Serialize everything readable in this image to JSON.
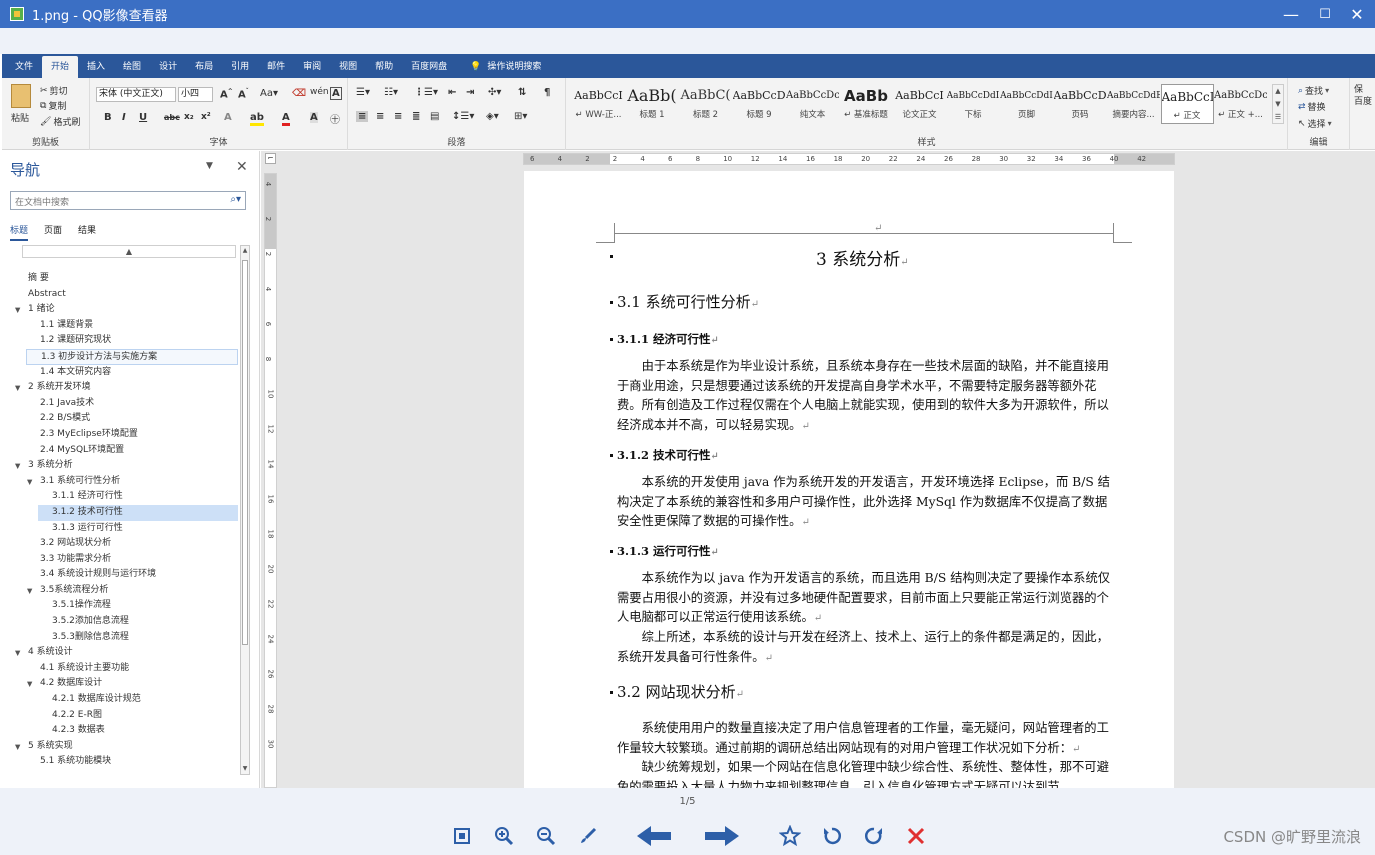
{
  "window": {
    "title": "1.png - QQ影像查看器",
    "minimize": "—",
    "maximize": "☐",
    "close": "✕"
  },
  "ribbon_tabs": [
    "文件",
    "开始",
    "插入",
    "绘图",
    "设计",
    "布局",
    "引用",
    "邮件",
    "审阅",
    "视图",
    "帮助",
    "百度网盘"
  ],
  "tell_me": "操作说明搜索",
  "clipboard": {
    "paste": "粘贴",
    "cut": "剪切",
    "copy": "复制",
    "format_painter": "格式刷",
    "label": "剪贴板"
  },
  "font": {
    "name": "宋体 (中文正文)",
    "size": "小四",
    "label": "字体"
  },
  "paragraph": {
    "label": "段落"
  },
  "styles": {
    "label": "样式",
    "items": [
      {
        "preview": "AaBbCcI",
        "name": "↵ WW-正..."
      },
      {
        "preview": "AaBb(",
        "name": "标题 1"
      },
      {
        "preview": "AaBbC(",
        "name": "标题 2"
      },
      {
        "preview": "AaBbCcD",
        "name": "标题 9"
      },
      {
        "preview": "AaBbCcDc",
        "name": "纯文本"
      },
      {
        "preview": "AaBb",
        "name": "↵ 基准标题"
      },
      {
        "preview": "AaBbCcI",
        "name": "论文正文"
      },
      {
        "preview": "AaBbCcDdI",
        "name": "下标"
      },
      {
        "preview": "AaBbCcDdI",
        "name": "页脚"
      },
      {
        "preview": "AaBbCcD",
        "name": "页码"
      },
      {
        "preview": "AaBbCcDdE",
        "name": "摘要内容..."
      },
      {
        "preview": "AaBbCcI",
        "name": "↵ 正文"
      },
      {
        "preview": "AaBbCcDc",
        "name": "↵ 正文 +..."
      }
    ]
  },
  "editing": {
    "find": "查找",
    "replace": "替换",
    "select": "选择",
    "label": "编辑",
    "extra": "保\n百度"
  },
  "nav": {
    "title": "导航",
    "search_placeholder": "在文档中搜索",
    "tabs": [
      "标题",
      "页面",
      "结果"
    ],
    "tree": [
      {
        "t": "摘  要",
        "lvl": 0,
        "arrow": ""
      },
      {
        "t": "Abstract",
        "lvl": 0,
        "arrow": ""
      },
      {
        "t": "1 绪论",
        "lvl": 0,
        "arrow": "▲"
      },
      {
        "t": "1.1 课题背景",
        "lvl": 1,
        "arrow": ""
      },
      {
        "t": "1.2 课题研究现状",
        "lvl": 1,
        "arrow": ""
      },
      {
        "t": "1.3 初步设计方法与实施方案",
        "lvl": 1,
        "arrow": "",
        "state": "box"
      },
      {
        "t": "1.4 本文研究内容",
        "lvl": 1,
        "arrow": ""
      },
      {
        "t": "2 系统开发环境",
        "lvl": 0,
        "arrow": "▲"
      },
      {
        "t": "2.1 Java技术",
        "lvl": 1,
        "arrow": ""
      },
      {
        "t": "2.2 B/S模式",
        "lvl": 1,
        "arrow": ""
      },
      {
        "t": "2.3 MyEclipse环境配置",
        "lvl": 1,
        "arrow": ""
      },
      {
        "t": "2.4 MySQL环境配置",
        "lvl": 1,
        "arrow": ""
      },
      {
        "t": "3 系统分析",
        "lvl": 0,
        "arrow": "▲"
      },
      {
        "t": "3.1 系统可行性分析",
        "lvl": 1,
        "arrow": "▲"
      },
      {
        "t": "3.1.1 经济可行性",
        "lvl": 2,
        "arrow": ""
      },
      {
        "t": "3.1.2 技术可行性",
        "lvl": 2,
        "arrow": "",
        "state": "hl"
      },
      {
        "t": "3.1.3 运行可行性",
        "lvl": 2,
        "arrow": ""
      },
      {
        "t": "3.2 网站现状分析",
        "lvl": 1,
        "arrow": ""
      },
      {
        "t": "3.3 功能需求分析",
        "lvl": 1,
        "arrow": ""
      },
      {
        "t": "3.4 系统设计规则与运行环境",
        "lvl": 1,
        "arrow": ""
      },
      {
        "t": "3.5系统流程分析",
        "lvl": 1,
        "arrow": "▲"
      },
      {
        "t": "3.5.1操作流程",
        "lvl": 2,
        "arrow": ""
      },
      {
        "t": "3.5.2添加信息流程",
        "lvl": 2,
        "arrow": ""
      },
      {
        "t": "3.5.3删除信息流程",
        "lvl": 2,
        "arrow": ""
      },
      {
        "t": "4 系统设计",
        "lvl": 0,
        "arrow": "▲"
      },
      {
        "t": "4.1 系统设计主要功能",
        "lvl": 1,
        "arrow": ""
      },
      {
        "t": "4.2 数据库设计",
        "lvl": 1,
        "arrow": "▲"
      },
      {
        "t": "4.2.1 数据库设计规范",
        "lvl": 2,
        "arrow": ""
      },
      {
        "t": "4.2.2 E-R图",
        "lvl": 2,
        "arrow": ""
      },
      {
        "t": "4.2.3 数据表",
        "lvl": 2,
        "arrow": ""
      },
      {
        "t": "5 系统实现",
        "lvl": 0,
        "arrow": "▲"
      },
      {
        "t": "5.1  系统功能模块",
        "lvl": 1,
        "arrow": ""
      }
    ]
  },
  "ruler": {
    "h_labels": [
      "6",
      "4",
      "2",
      "2",
      "4",
      "6",
      "8",
      "10",
      "12",
      "14",
      "16",
      "18",
      "20",
      "22",
      "24",
      "26",
      "28",
      "30",
      "32",
      "34",
      "36",
      "40",
      "42"
    ],
    "v_labels": [
      "4",
      "2",
      "2",
      "4",
      "6",
      "8",
      "10",
      "12",
      "14",
      "16",
      "18",
      "20",
      "22",
      "24",
      "26",
      "28",
      "30"
    ]
  },
  "doc": {
    "header_mark": "↵",
    "chapter": "3  系统分析",
    "s31": "3.1  系统可行性分析",
    "s311": "3.1.1  经济可行性",
    "p311": "由于本系统是作为毕业设计系统，且系统本身存在一些技术层面的缺陷，并不能直接用于商业用途，只是想要通过该系统的开发提高自身学术水平，不需要特定服务器等额外花费。所有创造及工作过程仅需在个人电脑上就能实现，使用到的软件大多为开源软件，所以经济成本并不高，可以轻易实现。",
    "s312": "3.1.2  技术可行性",
    "p312": "本系统的开发使用 java 作为系统开发的开发语言，开发环境选择 Eclipse，而 B/S 结构决定了本系统的兼容性和多用户可操作性，此外选择 MySql 作为数据库不仅提高了数据安全性更保障了数据的可操作性。",
    "s313": "3.1.3  运行可行性",
    "p313a": "本系统作为以 java 作为开发语言的系统，而且选用 B/S 结构则决定了要操作本系统仅需要占用很小的资源，并没有过多地硬件配置要求，目前市面上只要能正常运行浏览器的个人电脑都可以正常运行使用该系统。",
    "p313b": "综上所述，本系统的设计与开发在经济上、技术上、运行上的条件都是满足的，因此，系统开发具备可行性条件。",
    "s32": "3.2  网站现状分析",
    "p32a": "系统使用用户的数量直接决定了用户信息管理者的工作量，毫无疑问，网站管理者的工作量较大较繁琐。通过前期的调研总结出网站现有的对用户管理工作状况如下分析：",
    "p32b": "缺少统筹规划，如果一个网站在信息化管理中缺少综合性、系统性、整体性，那不可避免的需要投入大量人力物力来规划整理信息，引入信息化管理方式无疑可以达到节",
    "para_mark": "↵"
  },
  "viewer": {
    "page_indicator": "1/5",
    "watermark": "CSDN @旷野里流浪"
  },
  "colors": {
    "titlebar": "#3b6fc4",
    "ribbon_tab": "#2b579a",
    "viewer_bg": "#eef2f9",
    "icon_blue": "#2d5fa8",
    "icon_red": "#e03030"
  }
}
